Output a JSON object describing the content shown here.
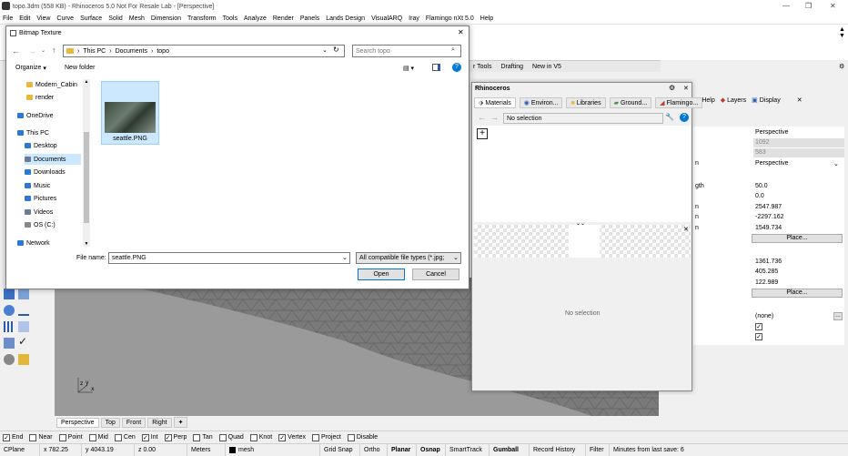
{
  "app": {
    "title": "topo.3dm (558 KB) - Rhinoceros 5.0 Not For Resale Lab - [Perspective]",
    "menu": [
      "File",
      "Edit",
      "View",
      "Curve",
      "Surface",
      "Solid",
      "Mesh",
      "Dimension",
      "Transform",
      "Tools",
      "Analyze",
      "Render",
      "Panels",
      "Lands Design",
      "VisualARQ",
      "Iray",
      "Flamingo nXt 5.0",
      "Help"
    ]
  },
  "toolbar_tabs": [
    "r Tools",
    "Drafting",
    "New in V5"
  ],
  "dialog": {
    "title": "Bitmap Texture",
    "breadcrumb": [
      "This PC",
      "Documents",
      "topo"
    ],
    "search_placeholder": "Search topo",
    "organize": "Organize",
    "new_folder": "New folder",
    "nav": [
      "Modern_Cabin",
      "render",
      "OneDrive",
      "This PC",
      "Desktop",
      "Documents",
      "Downloads",
      "Music",
      "Pictures",
      "Videos",
      "OS (C:)",
      "Network"
    ],
    "file": {
      "name": "seattle.PNG"
    },
    "file_name_label": "File name:",
    "file_name_value": "seattle.PNG",
    "file_type": "All compatible file types (*.jpg;",
    "open": "Open",
    "cancel": "Cancel"
  },
  "materials_panel": {
    "title": "Rhinoceros",
    "tabs": [
      "Materials",
      "Environ...",
      "Libraries",
      "Ground...",
      "Flamingo..."
    ],
    "selection": "No selection",
    "no_selection": "No selection",
    "plus": "+"
  },
  "right_panel": {
    "tabs": [
      "es",
      "Help",
      "Layers",
      "Display"
    ],
    "rows": [
      {
        "label": "",
        "value": "Perspective"
      },
      {
        "label": "",
        "value": "1092"
      },
      {
        "label": "",
        "value": "583"
      },
      {
        "label": "n",
        "value": "Perspective"
      },
      {
        "label": "gth",
        "value": "50.0"
      },
      {
        "label": "",
        "value": "0.0"
      },
      {
        "label": "n",
        "value": "2547.987"
      },
      {
        "label": "n",
        "value": "-2297.162"
      },
      {
        "label": "n",
        "value": "1549.734"
      },
      {
        "label": "",
        "value": "Place..."
      },
      {
        "label": "",
        "value": "1361.736"
      },
      {
        "label": "",
        "value": "405.285"
      },
      {
        "label": "",
        "value": "122.989"
      },
      {
        "label": "",
        "value": "Place..."
      },
      {
        "label": "",
        "value": "(none)"
      }
    ]
  },
  "viewport_tabs": [
    "Perspective",
    "Top",
    "Front",
    "Right"
  ],
  "osnaps": [
    {
      "label": "End",
      "checked": true
    },
    {
      "label": "Near",
      "checked": false
    },
    {
      "label": "Point",
      "checked": false
    },
    {
      "label": "Mid",
      "checked": false
    },
    {
      "label": "Cen",
      "checked": false
    },
    {
      "label": "Int",
      "checked": true
    },
    {
      "label": "Perp",
      "checked": true
    },
    {
      "label": "Tan",
      "checked": false
    },
    {
      "label": "Quad",
      "checked": false
    },
    {
      "label": "Knot",
      "checked": false
    },
    {
      "label": "Vertex",
      "checked": true
    },
    {
      "label": "Project",
      "checked": false
    },
    {
      "label": "Disable",
      "checked": false
    }
  ],
  "status": {
    "cplane": "CPlane",
    "x": "x 782.25",
    "y": "y 4043.19",
    "z": "z 0.00",
    "units": "Meters",
    "layer": "mesh",
    "grid_snap": "Grid Snap",
    "ortho": "Ortho",
    "planar": "Planar",
    "osnap": "Osnap",
    "smarttrack": "SmartTrack",
    "gumball": "Gumball",
    "record_history": "Record History",
    "filter": "Filter",
    "last_save": "Minutes from last save: 6"
  },
  "colors": {
    "accent": "#0078d7",
    "selection": "#cce8ff",
    "viewport": "#9a9a9a"
  }
}
